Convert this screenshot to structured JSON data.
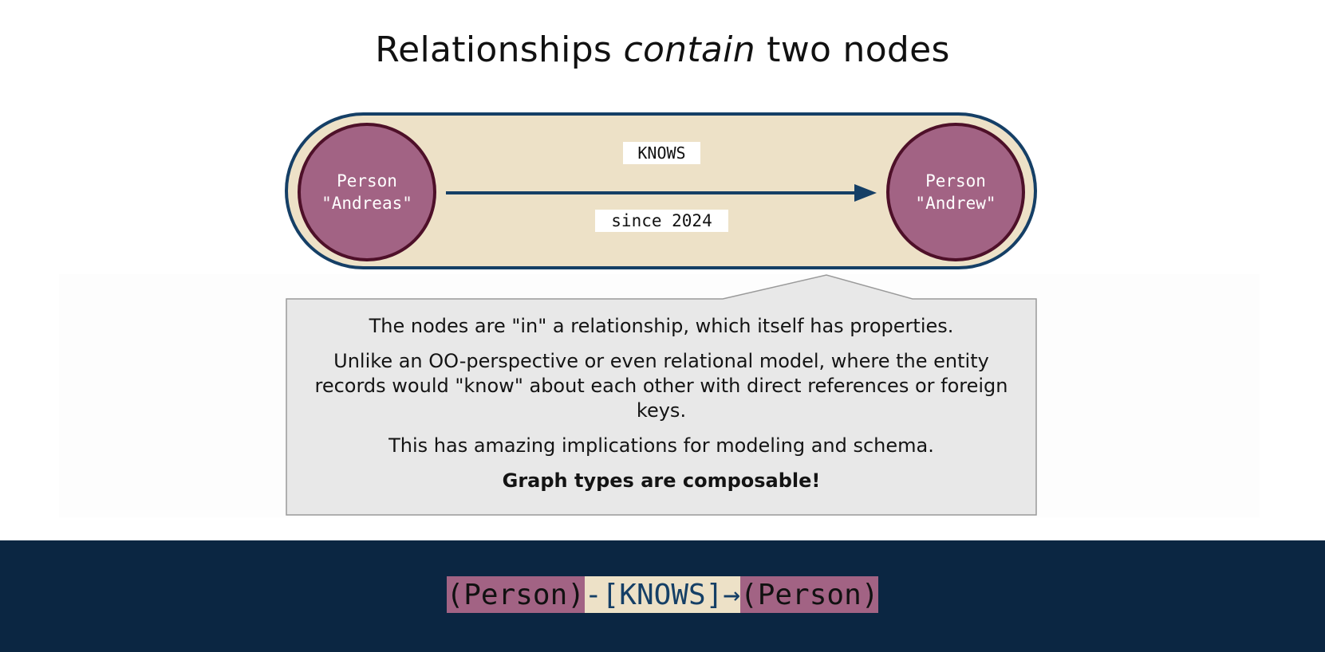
{
  "title": {
    "prefix": "Relationships ",
    "emphasis": "contain",
    "suffix": " two nodes"
  },
  "diagram": {
    "left_node": {
      "label": "Person",
      "name": "\"Andreas\""
    },
    "right_node": {
      "label": "Person",
      "name": "\"Andrew\""
    },
    "relationship": {
      "type": "KNOWS",
      "property": "since 2024"
    },
    "colors": {
      "node_fill": "#a26384",
      "node_border": "#4e1029",
      "relationship_fill": "#ede1c7",
      "relationship_border": "#153f66",
      "arrow": "#153f66"
    }
  },
  "callout": {
    "paragraphs": [
      "The nodes are \"in\" a relationship, which itself has properties.",
      "Unlike an OO-perspective or even relational model, where the entity records would \"know\" about each other with direct references or foreign keys.",
      "This has amazing implications for modeling and schema."
    ],
    "emphasis": "Graph types are composable!"
  },
  "pattern": {
    "left_node": "(Person)",
    "relationship": "-[KNOWS]→",
    "right_node": "(Person)",
    "background": "#0b2642"
  }
}
